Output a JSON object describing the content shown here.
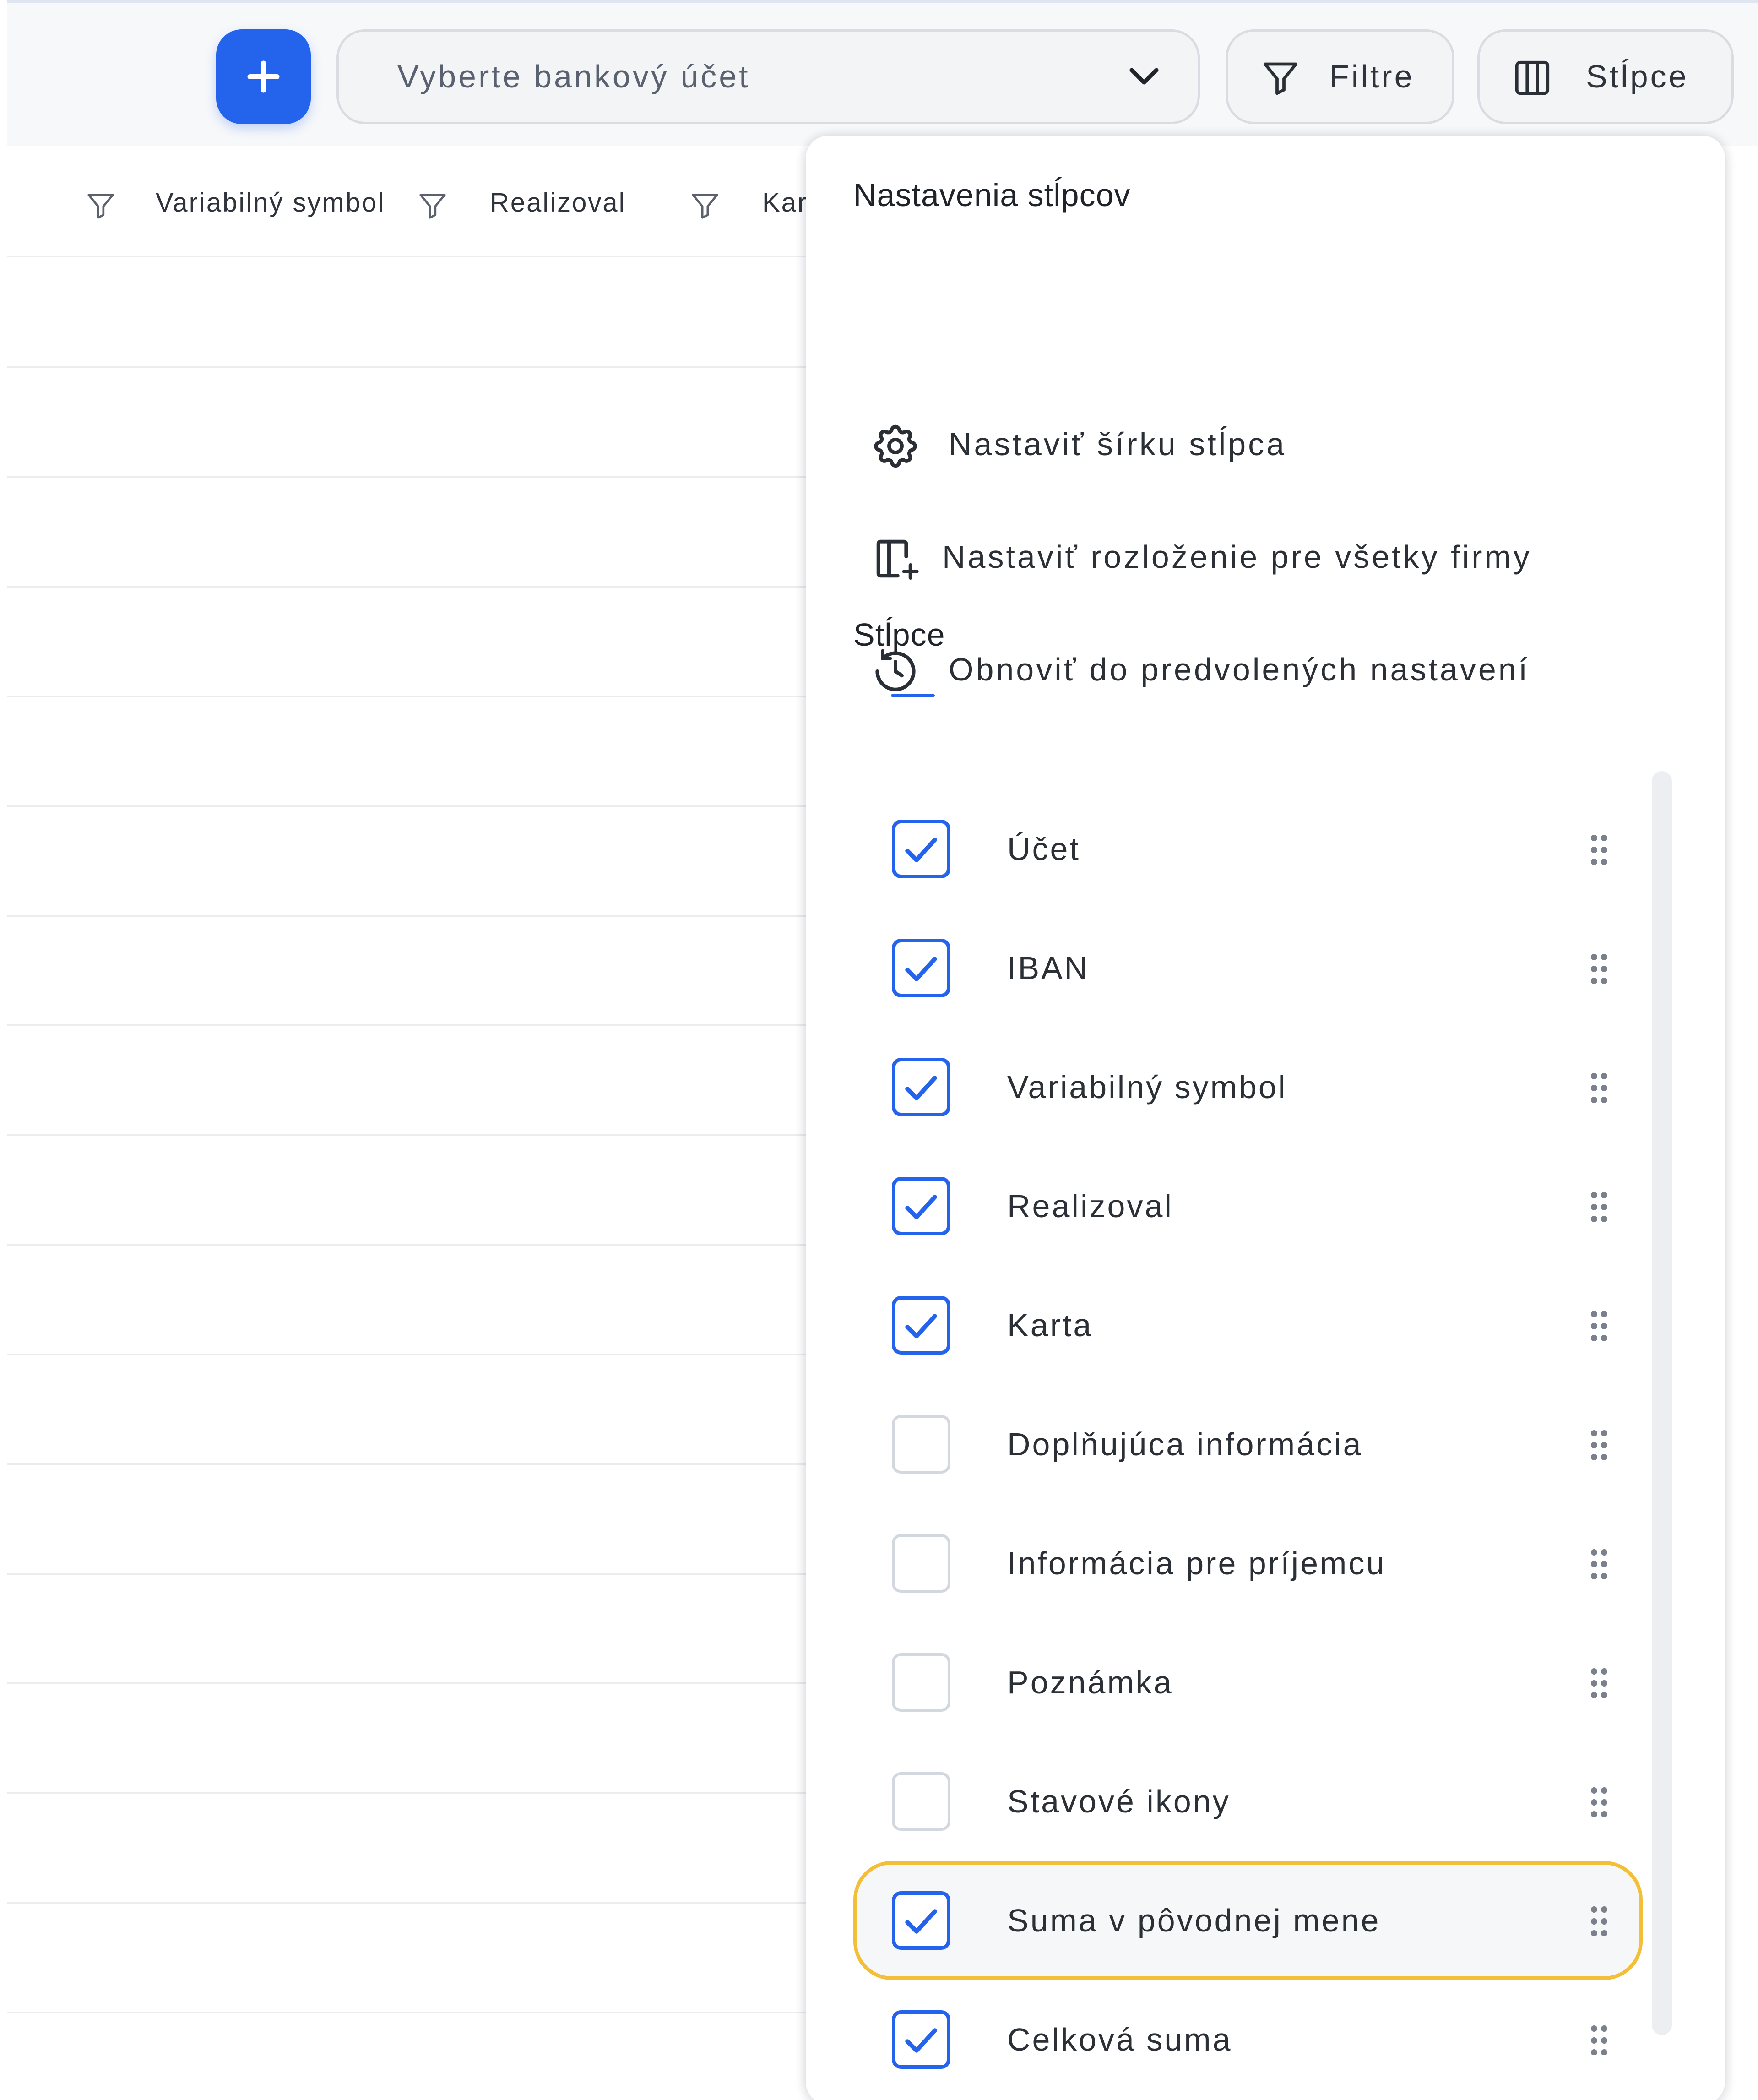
{
  "toolbar": {
    "add_label": "+",
    "account_select": {
      "placeholder": "Vyberte bankový účet",
      "icon": "chevron-down-icon"
    },
    "filters_label": "Filtre",
    "columns_label": "Stĺpce"
  },
  "table": {
    "header": {
      "col_variable_symbol": "Variabilný symbol",
      "col_realizoval": "Realizoval",
      "col_karta_partial": "Kar"
    },
    "empty_row_count": 16
  },
  "column_settings": {
    "heading": "Nastavenia stĺpcov",
    "actions": [
      {
        "label": "Nastaviť šírku stĺpca",
        "icon": "gear-icon"
      },
      {
        "label": "Nastaviť rozloženie pre všetky firmy",
        "icon": "layout-add-icon"
      },
      {
        "label": "Obnoviť do predvolených nastavení",
        "icon": "history-icon"
      }
    ],
    "columns_heading": "Stĺpce",
    "columns": [
      {
        "label": "Účet",
        "checked": true,
        "highlighted": false
      },
      {
        "label": "IBAN",
        "checked": true,
        "highlighted": false
      },
      {
        "label": "Variabilný symbol",
        "checked": true,
        "highlighted": false
      },
      {
        "label": "Realizoval",
        "checked": true,
        "highlighted": false
      },
      {
        "label": "Karta",
        "checked": true,
        "highlighted": false
      },
      {
        "label": "Doplňujúca informácia",
        "checked": false,
        "highlighted": false
      },
      {
        "label": "Informácia pre príjemcu",
        "checked": false,
        "highlighted": false
      },
      {
        "label": "Poznámka",
        "checked": false,
        "highlighted": false
      },
      {
        "label": "Stavové ikony",
        "checked": false,
        "highlighted": false
      },
      {
        "label": "Suma v pôvodnej mene",
        "checked": true,
        "highlighted": true
      },
      {
        "label": "Celková suma",
        "checked": true,
        "highlighted": false
      }
    ]
  },
  "colors": {
    "accent": "#2463eb",
    "highlight_border": "#f4bf38",
    "checkbox_off": "#d3d7de"
  }
}
